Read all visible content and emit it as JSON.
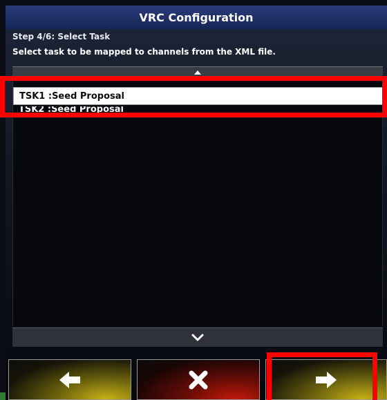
{
  "dialog": {
    "title": "VRC Configuration",
    "step": "Step 4/6: Select Task",
    "instruction": "Select task to be mapped to channels from the XML file."
  },
  "tasks": [
    {
      "label": "TSK1 :Seed Proposal",
      "selected": true
    },
    {
      "label": "TSK2 :Seed Proposal",
      "selected": false
    }
  ],
  "icons": {
    "scroll_up": "triangle-up-icon",
    "scroll_down": "chevron-down-icon",
    "back": "arrow-left-icon",
    "cancel": "x-icon",
    "next": "arrow-right-icon"
  },
  "colors": {
    "title_bar": "#1f2f66",
    "highlight": "#ff0000",
    "back_next_glow": "#c9b215",
    "cancel_glow": "#c01a0a"
  }
}
